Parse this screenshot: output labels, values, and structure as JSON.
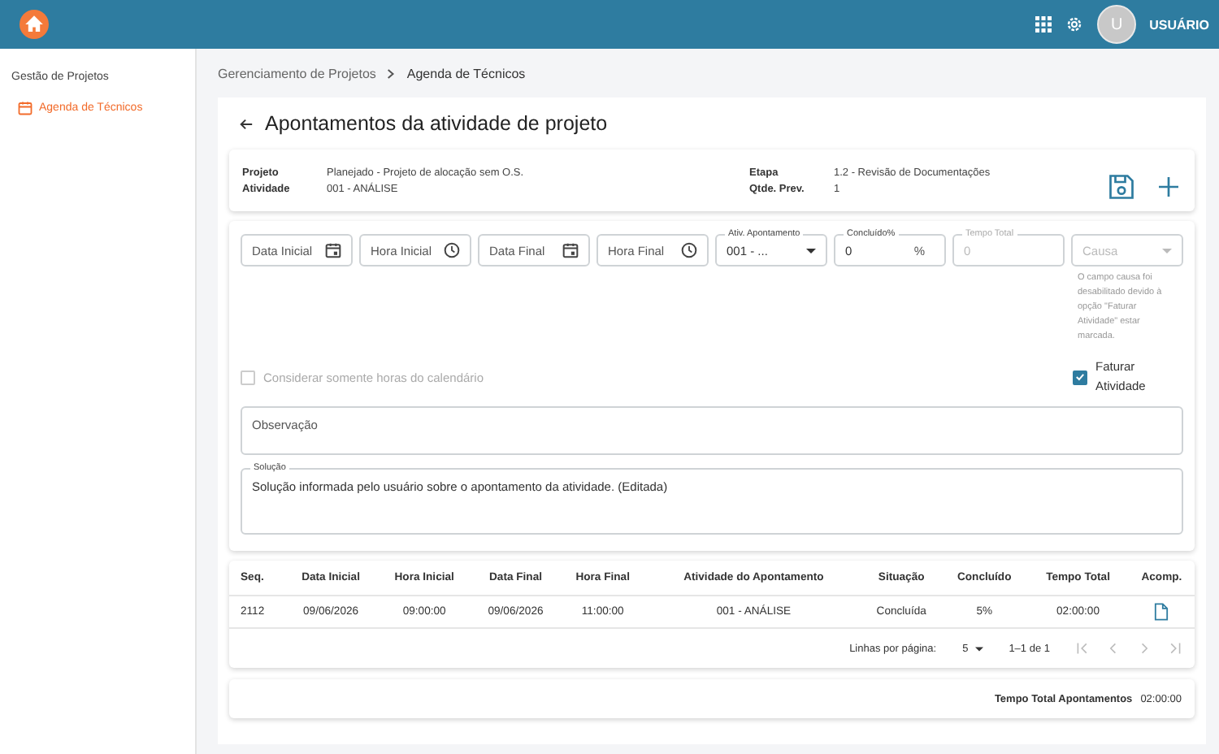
{
  "header": {
    "avatar_initial": "U",
    "user_name": "USUÁRIO"
  },
  "sidebar": {
    "section": "Gestão de Projetos",
    "items": [
      {
        "label": "Agenda de Técnicos",
        "selected": true
      }
    ]
  },
  "breadcrumb": [
    "Gerenciamento de Projetos",
    "Agenda de Técnicos"
  ],
  "page_title": "Apontamentos da atividade de projeto",
  "info": [
    {
      "label": "Projeto",
      "value": "Planejado - Projeto de alocação sem O.S."
    },
    {
      "label": "Atividade",
      "value": "001 - ANÁLISE"
    },
    {
      "label": "Etapa",
      "value": "1.2 - Revisão de Documentações"
    },
    {
      "label": "Qtde. Prev.",
      "value": "1"
    }
  ],
  "fields": [
    {
      "kind": "date",
      "placeholder": "Data Inicial",
      "disabled": false
    },
    {
      "kind": "time",
      "placeholder": "Hora Inicial",
      "disabled": false
    },
    {
      "kind": "date",
      "placeholder": "Data Final",
      "disabled": false
    },
    {
      "kind": "time",
      "placeholder": "Hora Final",
      "disabled": false
    },
    {
      "kind": "select",
      "label": "Ativ. Apontamento",
      "value": "001 - ...",
      "disabled": false
    },
    {
      "kind": "number",
      "label": "Concluído%",
      "value": "0",
      "suffix": "%",
      "disabled": false
    },
    {
      "kind": "text",
      "label": "Tempo Total",
      "value": "0",
      "disabled": true
    },
    {
      "kind": "select",
      "placeholder": "Causa",
      "disabled": true,
      "helper": "O campo causa foi desabilitado devido à opção \"Faturar Atividade\" estar marcada."
    }
  ],
  "checkboxes": [
    {
      "label": "Considerar somente horas do calendário",
      "checked": false,
      "disabled": true
    },
    {
      "label": "Faturar Atividade",
      "checked": true,
      "disabled": false
    }
  ],
  "observacao": {
    "placeholder": "Observação"
  },
  "solucao": {
    "label": "Solução",
    "value": "Solução informada pelo usuário sobre o apontamento da atividade. (Editada)"
  },
  "table": {
    "columns": [
      "Seq.",
      "Data Inicial",
      "Hora Inicial",
      "Data Final",
      "Hora Final",
      "Atividade do Apontamento",
      "Situação",
      "Concluído",
      "Tempo Total",
      "Acomp."
    ],
    "rows": [
      [
        "2112",
        "09/06/2026",
        "09:00:00",
        "09/06/2026",
        "11:00:00",
        "001 - ANÁLISE",
        "Concluída",
        "5%",
        "02:00:00"
      ]
    ]
  },
  "pagination": {
    "label": "Linhas por página:",
    "per_page": "5",
    "range": "1–1 de 1"
  },
  "total": {
    "label": "Tempo Total Apontamentos",
    "value": "02:00:00"
  }
}
